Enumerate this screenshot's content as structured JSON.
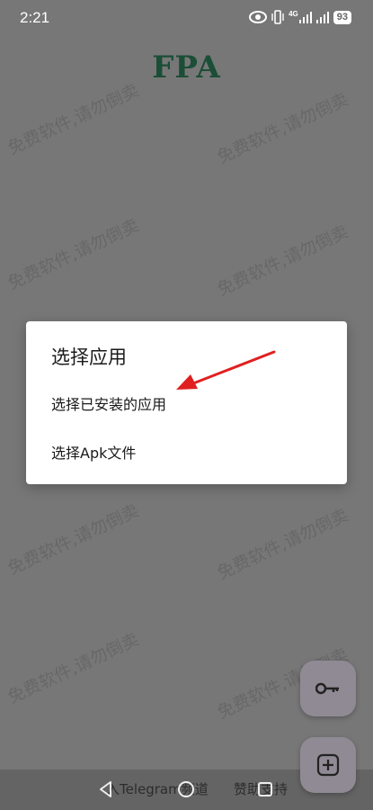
{
  "status_bar": {
    "time": "2:21",
    "network": "4G",
    "battery": "93",
    "icons": [
      "eye-icon",
      "vibrate-icon",
      "signal-icon",
      "signal-icon-2",
      "battery-icon"
    ]
  },
  "app": {
    "title": "FPA"
  },
  "watermark": {
    "text": "免费软件,请勿倒卖"
  },
  "dialog": {
    "title": "选择应用",
    "options": [
      {
        "label": "选择已安装的应用"
      },
      {
        "label": "选择Apk文件"
      }
    ]
  },
  "annotation": {
    "arrow_color": "#e02020"
  },
  "fabs": {
    "key_icon": "key-icon",
    "add_icon": "add-icon"
  },
  "bottom": {
    "left_link": "入Telegram频道",
    "right_link": "赞助支持"
  },
  "nav": {
    "back": "back-icon",
    "home": "home-icon",
    "recents": "recents-icon"
  },
  "colors": {
    "title": "#1b4e37",
    "fab": "#8f8a93",
    "scrim": "#777777"
  }
}
